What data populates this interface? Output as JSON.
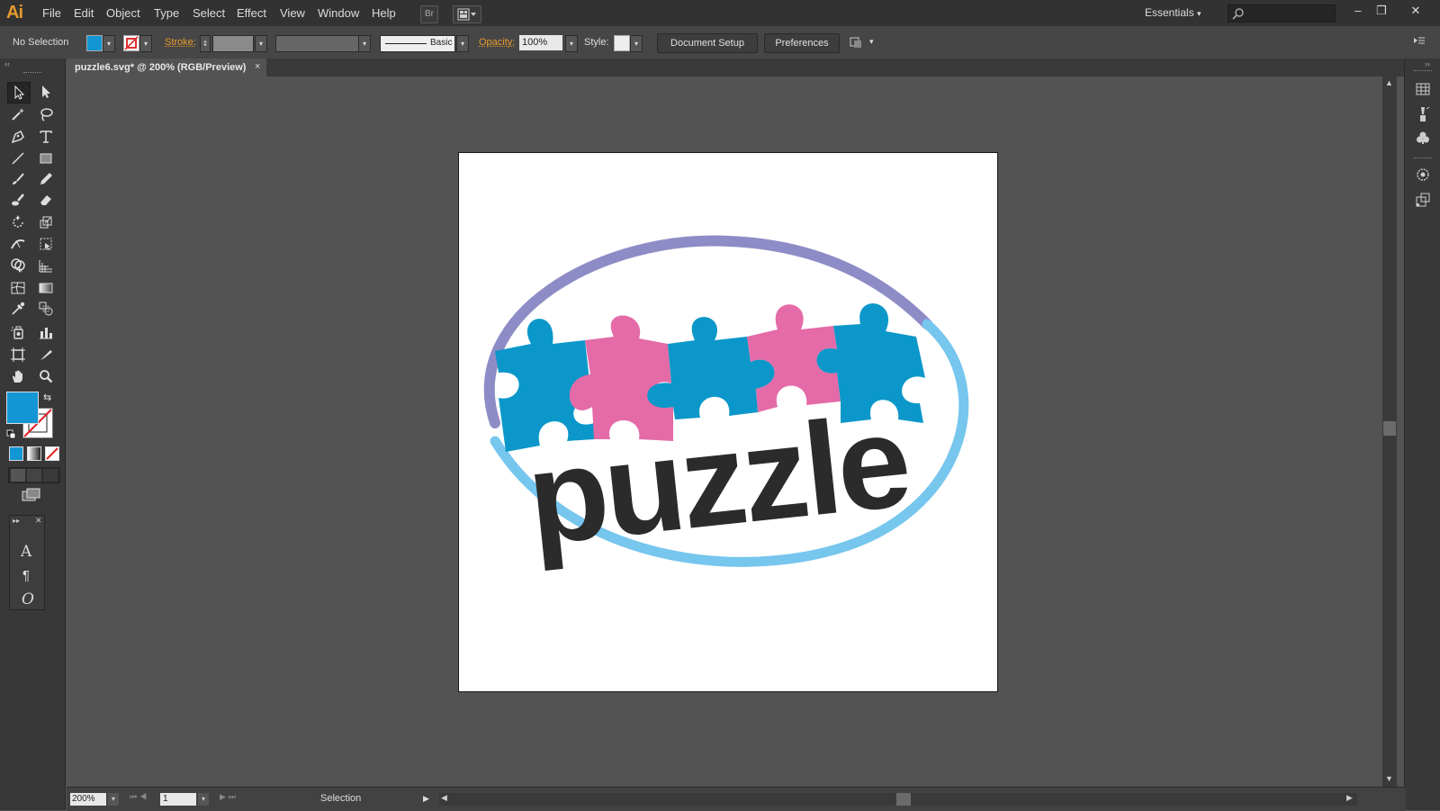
{
  "app": {
    "logo": "Ai"
  },
  "menu": [
    "File",
    "Edit",
    "Object",
    "Type",
    "Select",
    "Effect",
    "View",
    "Window",
    "Help"
  ],
  "menubar": {
    "bridge_label": "Br",
    "workspace": "Essentials",
    "workspace_arrow": "▾"
  },
  "window_controls": {
    "minimize": "–",
    "restore": "❐",
    "close": "✕"
  },
  "controlbar": {
    "selection_status": "No Selection",
    "stroke_label": "Stroke:",
    "brush_label": "Basic",
    "opacity_label": "Opacity:",
    "opacity_value": "100%",
    "style_label": "Style:",
    "document_setup": "Document Setup",
    "preferences": "Preferences",
    "fill_color": "#1296d4"
  },
  "document": {
    "tab_title": "puzzle6.svg* @ 200% (RGB/Preview)",
    "close": "×"
  },
  "artwork": {
    "word": "puzzle",
    "colors": {
      "blue": "#0b97c9",
      "pink": "#e46ba8",
      "ring_purple": "#8e8cc6",
      "ring_blue": "#76c6ee",
      "text": "#2b2b2b"
    }
  },
  "status": {
    "zoom": "200%",
    "artboard_number": "1",
    "tool": "Selection",
    "arrow_next": "▶"
  }
}
